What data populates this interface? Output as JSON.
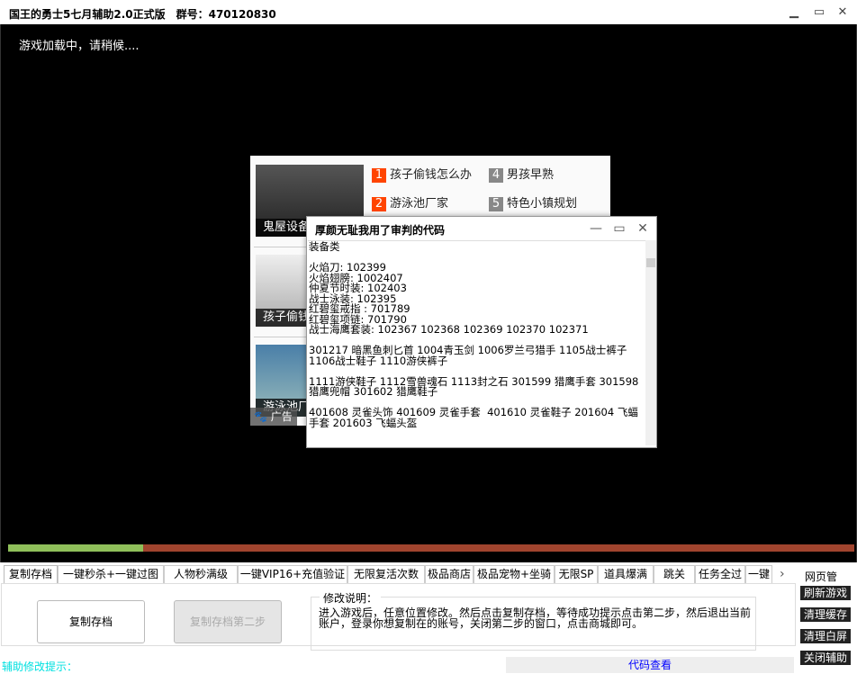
{
  "window": {
    "title": "国王的勇士5七月辅助2.0正式版　群号：470120830",
    "min": "▁",
    "max": "▭",
    "close": "✕"
  },
  "game": {
    "loading_text": "游戏加载中，请稍候....",
    "progress_percent": 16
  },
  "ad": {
    "captions": [
      "鬼屋设备",
      "孩子偷钱",
      "游泳池厂"
    ],
    "links": [
      {
        "num": "1",
        "text": "孩子偷钱怎么办"
      },
      {
        "num": "4",
        "text": "男孩早熟"
      },
      {
        "num": "2",
        "text": "游泳池厂家"
      },
      {
        "num": "5",
        "text": "特色小镇规划"
      }
    ],
    "tag": "广告",
    "num_colors": [
      "#ff4400",
      "#888888"
    ]
  },
  "popup": {
    "title": "厚颜无耻我用了审判的代码",
    "body": "装备类\n\n火焰刀: 102399\n火焰翅膀: 1002407\n仲夏节时装: 102403\n战士泳装: 102395\n红碧玺戒指 : 701789\n红碧玺项链: 701790\n战士海鹰套装: 102367 102368 102369 102370 102371\n\n301217 暗黑鱼刺匕首 1004青玉剑 1006罗兰弓猎手 1105战士裤子 1106战士鞋子 1110游侠裤子\n\n1111游侠鞋子 1112雪兽魂石 1113封之石 301599 猎鹰手套 301598 猎鹰兜帽 301602 猎鹰鞋子\n\n401608 灵雀头饰 401609 灵雀手套  401610 灵雀鞋子 201604 飞蝠手套 201603 飞蝠头盔"
  },
  "tabs": [
    "复制存档",
    "一键秒杀+一键过图",
    "人物秒满级",
    "一键VIP16+充值验证",
    "无限复活次数",
    "极品商店",
    "极品宠物+坐骑",
    "无限SP",
    "道具爆满",
    "跳关",
    "任务全过",
    "一键"
  ],
  "tab_nav": {
    "prev": "‹",
    "next": "›"
  },
  "panel": {
    "copy_button": "复制存档",
    "copy_step2_button": "复制存档第二步",
    "desc_title": "修改说明：",
    "desc_text": "进入游戏后，任意位置修改。然后点击复制存档，等待成功提示点击第二步，然后退出当前账户，登录你想复制在的账号，关闭第二步的窗口，点击商城即可。"
  },
  "footer": {
    "hint": "辅助修改提示：",
    "code_view": "代码查看"
  },
  "side": {
    "title": "网页管理：",
    "buttons": [
      "刷新游戏",
      "清理缓存",
      "清理白屏",
      "关闭辅助"
    ]
  }
}
